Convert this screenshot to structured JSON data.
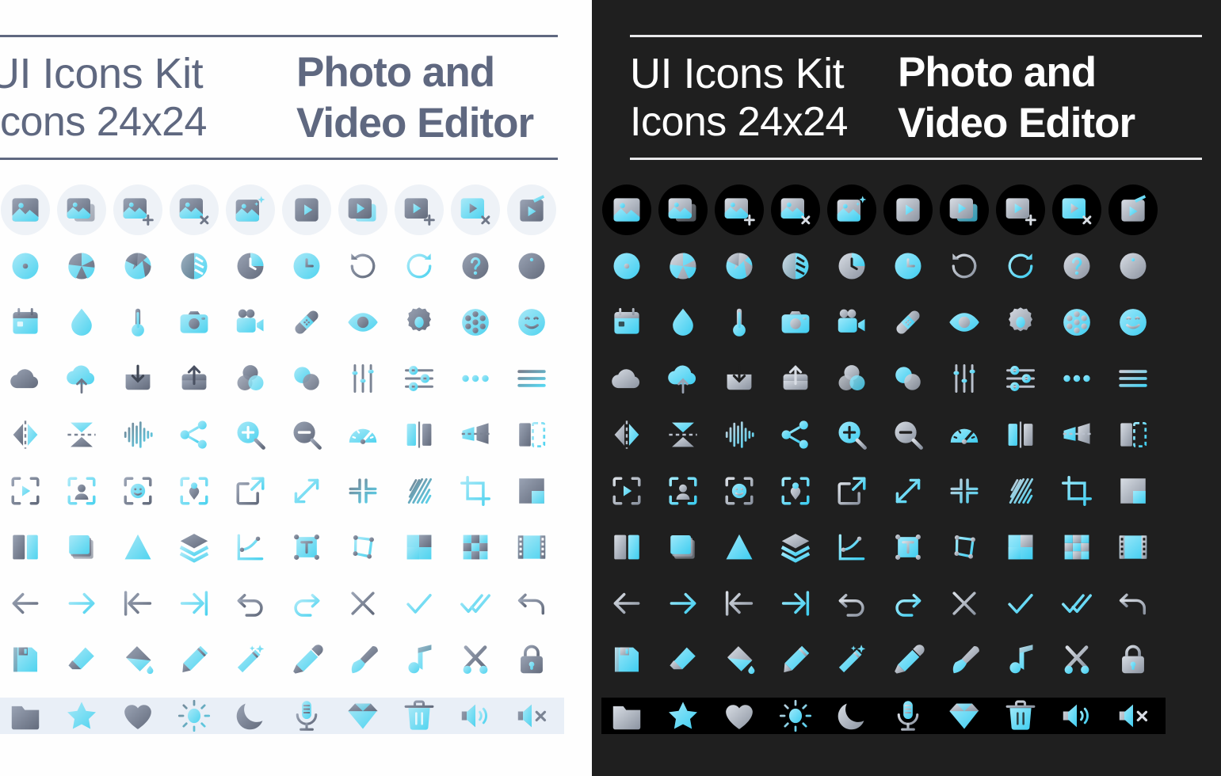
{
  "header": {
    "kit_title": "UI Icons Kit",
    "kit_subtitle": "Icons 24x24",
    "product_line1": "Photo and",
    "product_line2": "Video Editor"
  },
  "theme": {
    "light_bg": "#fefefe",
    "dark_bg": "#1f1f1f",
    "text_slate": "#5f6880",
    "text_white": "#ffffff",
    "accent_cyan": "#5fd8f5",
    "accent_cyan_light": "#7fe3f7",
    "accent_gray": "#6f7788",
    "disc_light": "#eef2f7",
    "disc_dark": "#000000",
    "band_light": "#e9eff7",
    "band_dark": "#000000",
    "rule_light": "#5f6880",
    "rule_dark": "#e8e8ea",
    "sub_band_light": "#e3ecf5",
    "sub_band_dark": "#000000"
  },
  "panels": [
    {
      "id": "light",
      "mode": "light"
    },
    {
      "id": "dark",
      "mode": "dark"
    }
  ],
  "grid": {
    "columns": 10,
    "rows": 10,
    "icon_size": "24x24",
    "col_pitch": 71,
    "row_pitch": 71,
    "disc_rows": [
      0
    ],
    "band_rows": [
      9
    ]
  },
  "icon_rows": [
    {
      "index": 0,
      "has_disc": true,
      "icons": [
        "image-icon",
        "images-stack-icon",
        "image-add-icon",
        "image-remove-icon",
        "image-magic-icon",
        "video-icon",
        "videos-stack-icon",
        "video-add-icon",
        "video-remove-icon",
        "video-edit-icon"
      ]
    },
    {
      "index": 1,
      "has_disc": false,
      "icons": [
        "lens-icon",
        "aperture-icon",
        "shutter-icon",
        "exposure-icon",
        "timer-clock-icon",
        "clock-icon",
        "rotate-left-icon",
        "rotate-right-icon",
        "help-icon",
        "info-icon"
      ]
    },
    {
      "index": 2,
      "has_disc": false,
      "icons": [
        "calendar-icon",
        "droplet-icon",
        "thermometer-icon",
        "camera-icon",
        "video-camera-icon",
        "bandage-icon",
        "eye-icon",
        "gear-icon",
        "film-reel-icon",
        "smiley-icon"
      ]
    },
    {
      "index": 3,
      "has_disc": false,
      "icons": [
        "cloud-icon",
        "cloud-upload-icon",
        "download-icon",
        "upload-icon",
        "color-mix-icon",
        "overlap-icon",
        "equalizer-icon",
        "sliders-icon",
        "more-dots-icon",
        "menu-icon"
      ]
    },
    {
      "index": 4,
      "has_disc": false,
      "icons": [
        "flip-horizontal-icon",
        "flip-vertical-icon",
        "waveform-icon",
        "share-icon",
        "zoom-in-icon",
        "zoom-out-icon",
        "speedometer-icon",
        "contrast-icon",
        "perspective-icon",
        "panel-edge-icon"
      ]
    },
    {
      "index": 5,
      "has_disc": false,
      "icons": [
        "detect-video-icon",
        "detect-person-icon",
        "detect-face-icon",
        "detect-object-icon",
        "open-external-icon",
        "expand-diagonal-icon",
        "collapse-icon",
        "hatch-pattern-icon",
        "crop-icon",
        "mask-corner-icon"
      ]
    },
    {
      "index": 6,
      "has_disc": false,
      "icons": [
        "split-view-icon",
        "duplicate-icon",
        "triangle-icon",
        "layers-icon",
        "curve-icon",
        "text-box-icon",
        "transform-icon",
        "color-blocks-icon",
        "checkerboard-icon",
        "film-strip-icon"
      ]
    },
    {
      "index": 7,
      "has_disc": false,
      "icons": [
        "arrow-left-icon",
        "arrow-right-icon",
        "arrow-to-start-icon",
        "arrow-to-end-icon",
        "undo-icon",
        "redo-icon",
        "close-icon",
        "check-icon",
        "double-check-icon",
        "restore-icon"
      ]
    },
    {
      "index": 8,
      "has_disc": false,
      "icons": [
        "save-icon",
        "eraser-icon",
        "paint-bucket-icon",
        "pencil-icon",
        "magic-wand-icon",
        "eyedropper-icon",
        "brush-icon",
        "music-note-icon",
        "scissors-icon",
        "lock-icon"
      ]
    },
    {
      "index": 9,
      "has_disc": false,
      "has_band": true,
      "icons": [
        "folder-icon",
        "star-icon",
        "heart-icon",
        "sun-icon",
        "moon-icon",
        "microphone-icon",
        "diamond-icon",
        "trash-icon",
        "volume-icon",
        "volume-mute-icon"
      ]
    }
  ]
}
